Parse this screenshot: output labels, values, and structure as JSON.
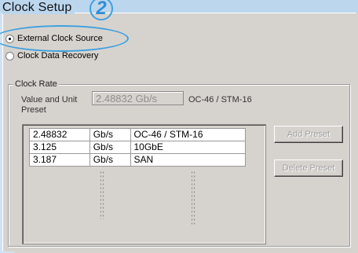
{
  "title": "Clock Setup",
  "callout_number": "2",
  "radios": [
    {
      "label": "External Clock Source",
      "checked": true
    },
    {
      "label": "Clock Data Recovery",
      "checked": false
    }
  ],
  "clock_rate": {
    "group_label": "Clock Rate",
    "value_and_unit_label": "Value and Unit",
    "preset_label": "Preset",
    "value_field": "2.48832 Gb/s",
    "standard_text": "OC-46 / STM-16",
    "presets": [
      {
        "value": "2.48832",
        "unit": "Gb/s",
        "name": "OC-46 / STM-16"
      },
      {
        "value": "3.125",
        "unit": "Gb/s",
        "name": "10GbE"
      },
      {
        "value": "3.187",
        "unit": "Gb/s",
        "name": "SAN"
      }
    ],
    "add_preset_label": "Add Preset",
    "delete_preset_label": "Delete Preset"
  },
  "colors": {
    "accent": "#3fa0e0",
    "panel": "#d6d3ce",
    "title_band": "#bcd6ee"
  }
}
